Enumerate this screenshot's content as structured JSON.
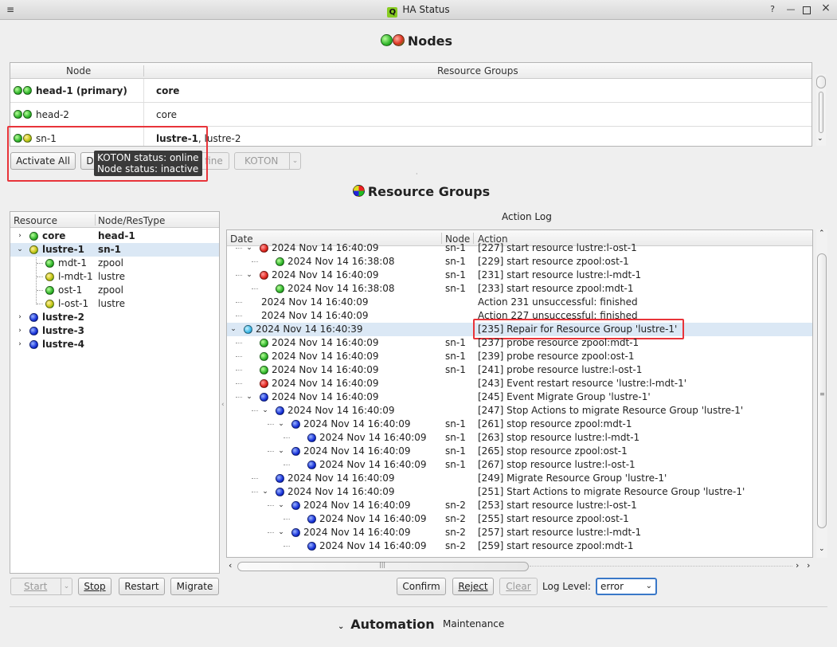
{
  "window": {
    "title": "HA Status",
    "app_icon": "Q"
  },
  "nodes_section": {
    "title": "Nodes",
    "columns": [
      "Node",
      "Resource Groups"
    ],
    "rows": [
      {
        "leds": [
          "g",
          "g"
        ],
        "name": "head-1 (primary)",
        "groups_bold": "core",
        "groups_rest": ""
      },
      {
        "leds": [
          "g",
          "g"
        ],
        "name": "head-2",
        "groups_bold": "",
        "groups_rest": "core"
      },
      {
        "leds": [
          "g",
          "y"
        ],
        "name": "sn-1",
        "groups_bold": "lustre-1",
        "groups_rest": ", lustre-2"
      }
    ],
    "buttons": {
      "activate_all": "Activate All",
      "d": "D",
      "fine": "fine",
      "koton": "KOTON"
    },
    "tooltip": {
      "line1": "KOTON status: online",
      "line2": "Node status: inactive"
    }
  },
  "resource_groups_section": {
    "title": "Resource Groups",
    "tree_columns": [
      "Resource",
      "Node/ResType"
    ],
    "tree": [
      {
        "level": 0,
        "arrow": "›",
        "led": "g",
        "name": "core",
        "type": "head-1",
        "bold": true
      },
      {
        "level": 0,
        "arrow": "⌄",
        "led": "y",
        "name": "lustre-1",
        "type": "sn-1",
        "bold": true,
        "selected": true
      },
      {
        "level": 1,
        "arrow": "",
        "led": "g",
        "name": "mdt-1",
        "type": "zpool",
        "bold": false
      },
      {
        "level": 1,
        "arrow": "",
        "led": "y",
        "name": "l-mdt-1",
        "type": "lustre",
        "bold": false
      },
      {
        "level": 1,
        "arrow": "",
        "led": "g",
        "name": "ost-1",
        "type": "zpool",
        "bold": false
      },
      {
        "level": 1,
        "arrow": "",
        "led": "y",
        "name": "l-ost-1",
        "type": "lustre",
        "bold": false
      },
      {
        "level": 0,
        "arrow": "›",
        "led": "b",
        "name": "lustre-2",
        "type": "",
        "bold": true
      },
      {
        "level": 0,
        "arrow": "›",
        "led": "b",
        "name": "lustre-3",
        "type": "",
        "bold": true
      },
      {
        "level": 0,
        "arrow": "›",
        "led": "b",
        "name": "lustre-4",
        "type": "",
        "bold": true
      }
    ],
    "buttons": {
      "start": "Start",
      "stop": "Stop",
      "restart": "Restart",
      "migrate": "Migrate"
    }
  },
  "action_log": {
    "title": "Action Log",
    "columns": [
      "Date",
      "Node",
      "Action"
    ],
    "rows": [
      {
        "indent": 1,
        "arrow": "⌄",
        "led": "r",
        "date": "2024 Nov 14 16:40:09",
        "node": "sn-1",
        "action": "[227] start resource lustre:l-ost-1"
      },
      {
        "indent": 2,
        "arrow": "",
        "led": "g",
        "date": "2024 Nov 14 16:38:08",
        "node": "sn-1",
        "action": "[229] start resource zpool:ost-1"
      },
      {
        "indent": 1,
        "arrow": "⌄",
        "led": "r",
        "date": "2024 Nov 14 16:40:09",
        "node": "sn-1",
        "action": "[231] start resource lustre:l-mdt-1"
      },
      {
        "indent": 2,
        "arrow": "",
        "led": "g",
        "date": "2024 Nov 14 16:38:08",
        "node": "sn-1",
        "action": "[233] start resource zpool:mdt-1"
      },
      {
        "indent": 1,
        "arrow": "",
        "led": "",
        "date": "2024 Nov 14 16:40:09",
        "node": "",
        "action": "Action 231 unsuccessful: finished"
      },
      {
        "indent": 1,
        "arrow": "",
        "led": "",
        "date": "2024 Nov 14 16:40:09",
        "node": "",
        "action": "Action 227 unsuccessful: finished"
      },
      {
        "indent": 0,
        "arrow": "⌄",
        "led": "c",
        "date": "2024 Nov 14 16:40:39",
        "node": "",
        "action": "[235] Repair for Resource Group 'lustre-1'",
        "selected": true
      },
      {
        "indent": 1,
        "arrow": "",
        "led": "g",
        "date": "2024 Nov 14 16:40:09",
        "node": "sn-1",
        "action": "[237] probe resource zpool:mdt-1"
      },
      {
        "indent": 1,
        "arrow": "",
        "led": "g",
        "date": "2024 Nov 14 16:40:09",
        "node": "sn-1",
        "action": "[239] probe resource zpool:ost-1"
      },
      {
        "indent": 1,
        "arrow": "",
        "led": "g",
        "date": "2024 Nov 14 16:40:09",
        "node": "sn-1",
        "action": "[241] probe resource lustre:l-ost-1"
      },
      {
        "indent": 1,
        "arrow": "",
        "led": "r",
        "date": "2024 Nov 14 16:40:09",
        "node": "",
        "action": "[243] Event restart resource 'lustre:l-mdt-1'"
      },
      {
        "indent": 1,
        "arrow": "⌄",
        "led": "b",
        "date": "2024 Nov 14 16:40:09",
        "node": "",
        "action": "[245] Event Migrate Group 'lustre-1'"
      },
      {
        "indent": 2,
        "arrow": "⌄",
        "led": "b",
        "date": "2024 Nov 14 16:40:09",
        "node": "",
        "action": "[247] Stop Actions to migrate Resource Group 'lustre-1'"
      },
      {
        "indent": 3,
        "arrow": "⌄",
        "led": "b",
        "date": "2024 Nov 14 16:40:09",
        "node": "sn-1",
        "action": "[261] stop resource zpool:mdt-1"
      },
      {
        "indent": 4,
        "arrow": "",
        "led": "b",
        "date": "2024 Nov 14 16:40:09",
        "node": "sn-1",
        "action": "[263] stop resource lustre:l-mdt-1"
      },
      {
        "indent": 3,
        "arrow": "⌄",
        "led": "b",
        "date": "2024 Nov 14 16:40:09",
        "node": "sn-1",
        "action": "[265] stop resource zpool:ost-1"
      },
      {
        "indent": 4,
        "arrow": "",
        "led": "b",
        "date": "2024 Nov 14 16:40:09",
        "node": "sn-1",
        "action": "[267] stop resource lustre:l-ost-1"
      },
      {
        "indent": 2,
        "arrow": "",
        "led": "b",
        "date": "2024 Nov 14 16:40:09",
        "node": "",
        "action": "[249] Migrate Resource Group 'lustre-1'"
      },
      {
        "indent": 2,
        "arrow": "⌄",
        "led": "b",
        "date": "2024 Nov 14 16:40:09",
        "node": "",
        "action": "[251] Start Actions to migrate Resource Group 'lustre-1'"
      },
      {
        "indent": 3,
        "arrow": "⌄",
        "led": "b",
        "date": "2024 Nov 14 16:40:09",
        "node": "sn-2",
        "action": "[253] start resource lustre:l-ost-1"
      },
      {
        "indent": 4,
        "arrow": "",
        "led": "b",
        "date": "2024 Nov 14 16:40:09",
        "node": "sn-2",
        "action": "[255] start resource zpool:ost-1"
      },
      {
        "indent": 3,
        "arrow": "⌄",
        "led": "b",
        "date": "2024 Nov 14 16:40:09",
        "node": "sn-2",
        "action": "[257] start resource lustre:l-mdt-1"
      },
      {
        "indent": 4,
        "arrow": "",
        "led": "b",
        "date": "2024 Nov 14 16:40:09",
        "node": "sn-2",
        "action": "[259] start resource zpool:mdt-1"
      }
    ],
    "buttons": {
      "confirm": "Confirm",
      "reject": "Reject",
      "clear": "Clear"
    },
    "log_level_label": "Log Level:",
    "log_level_value": "error"
  },
  "automation": {
    "title": "Automation",
    "maintenance": "Maintenance"
  }
}
